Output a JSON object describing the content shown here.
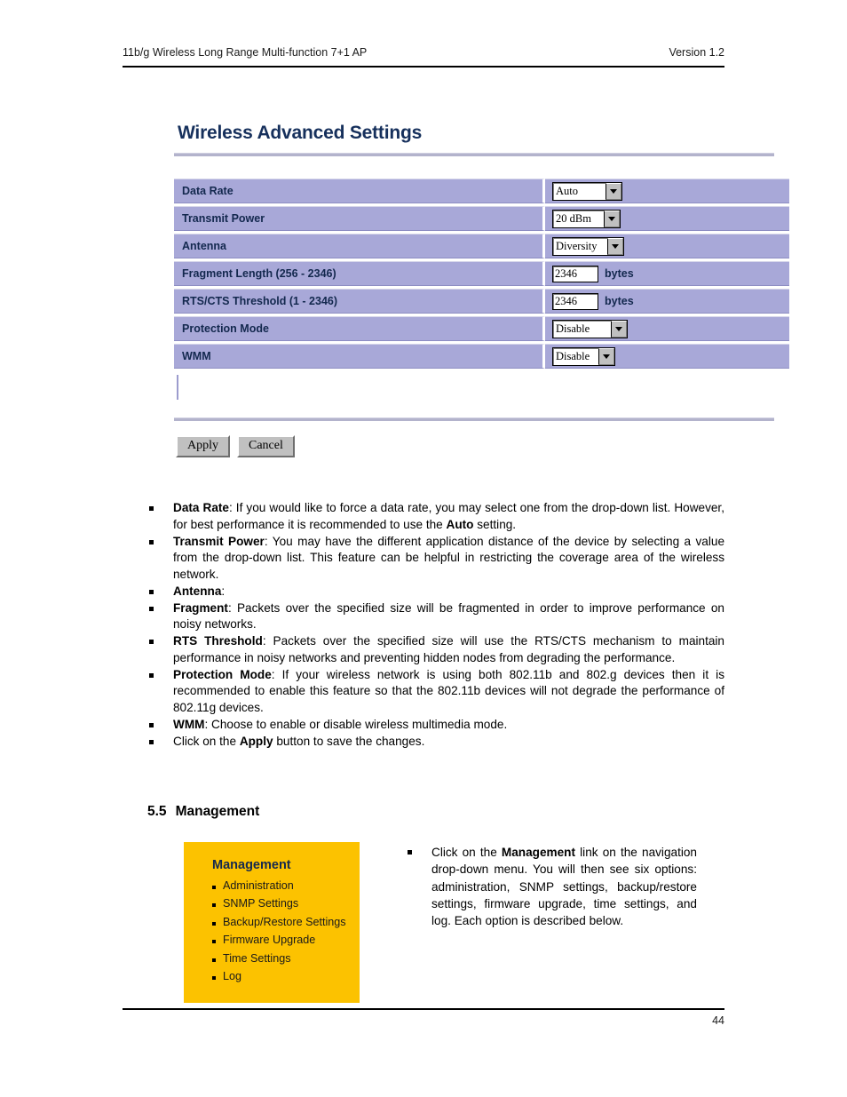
{
  "header": {
    "left_text": "11b/g Wireless Long Range Multi-function 7+1 AP",
    "right_text": "Version 1.2"
  },
  "panel": {
    "title": "Wireless Advanced Settings",
    "rows": [
      {
        "label": "Data Rate",
        "control": "select",
        "value": "Auto",
        "unit": ""
      },
      {
        "label": "Transmit Power",
        "control": "select",
        "value": "20 dBm",
        "unit": ""
      },
      {
        "label": "Antenna",
        "control": "select",
        "value": "Diversity",
        "unit": ""
      },
      {
        "label": "Fragment Length (256 - 2346)",
        "control": "text",
        "value": "2346",
        "unit": "bytes"
      },
      {
        "label": "RTS/CTS Threshold (1 - 2346)",
        "control": "text",
        "value": "2346",
        "unit": "bytes"
      },
      {
        "label": "Protection Mode",
        "control": "select",
        "value": "Disable",
        "unit": ""
      },
      {
        "label": "WMM",
        "control": "select",
        "value": "Disable",
        "unit": ""
      }
    ],
    "apply_label": "Apply",
    "cancel_label": "Cancel"
  },
  "bullets": [
    {
      "term": "Data Rate",
      "text": ": If you would like to force a data rate, you may select one from the drop-down list. However, for best performance it is recommended to use the ",
      "term2": "Auto",
      "text2": " setting."
    },
    {
      "term": "Transmit Power",
      "text": ": You may have the different application distance of the device by selecting a value from the drop-down list. This feature can be helpful in restricting the coverage area of the wireless network.",
      "term2": "",
      "text2": ""
    },
    {
      "term": "Antenna",
      "text": ":",
      "term2": "",
      "text2": ""
    },
    {
      "term": "Fragment",
      "text": ": Packets over the specified size will be fragmented in order to improve performance on noisy networks.",
      "term2": "",
      "text2": ""
    },
    {
      "term": "RTS Threshold",
      "text": ": Packets over the specified size will use the RTS/CTS mechanism to maintain performance in noisy networks and preventing hidden nodes from degrading the performance.",
      "term2": "",
      "text2": ""
    },
    {
      "term": "Protection Mode",
      "text": ": If your wireless network is using both 802.11b and 802.g devices then it is recommended to enable this feature so that the 802.11b devices will not degrade the performance of 802.11g devices.",
      "term2": "",
      "text2": ""
    },
    {
      "term": "WMM",
      "text": ": Choose to enable or disable wireless multimedia mode.",
      "term2": "",
      "text2": ""
    }
  ],
  "apply_bullet": {
    "lead": "Click on the ",
    "term": "Apply",
    "tail": " button to save the changes."
  },
  "section": {
    "number": "5.5",
    "title": "Management"
  },
  "management_menu": {
    "title": "Management",
    "items": [
      "Administration",
      "SNMP Settings",
      "Backup/Restore Settings",
      "Firmware Upgrade",
      "Time Settings",
      "Log"
    ]
  },
  "management_note": {
    "lead": "Click on the ",
    "term": "Management",
    "tail": " link on the navigation drop-down menu. You will then see six options: administration, SNMP settings, backup/restore settings, firmware upgrade, time settings, and log. Each option is described below."
  },
  "footer": {
    "page_number": "44"
  },
  "colors": {
    "table_row": "#a8a8d8",
    "panel_title": "#16305c",
    "menu_bg": "#fcc200",
    "menu_title": "#15294f"
  }
}
